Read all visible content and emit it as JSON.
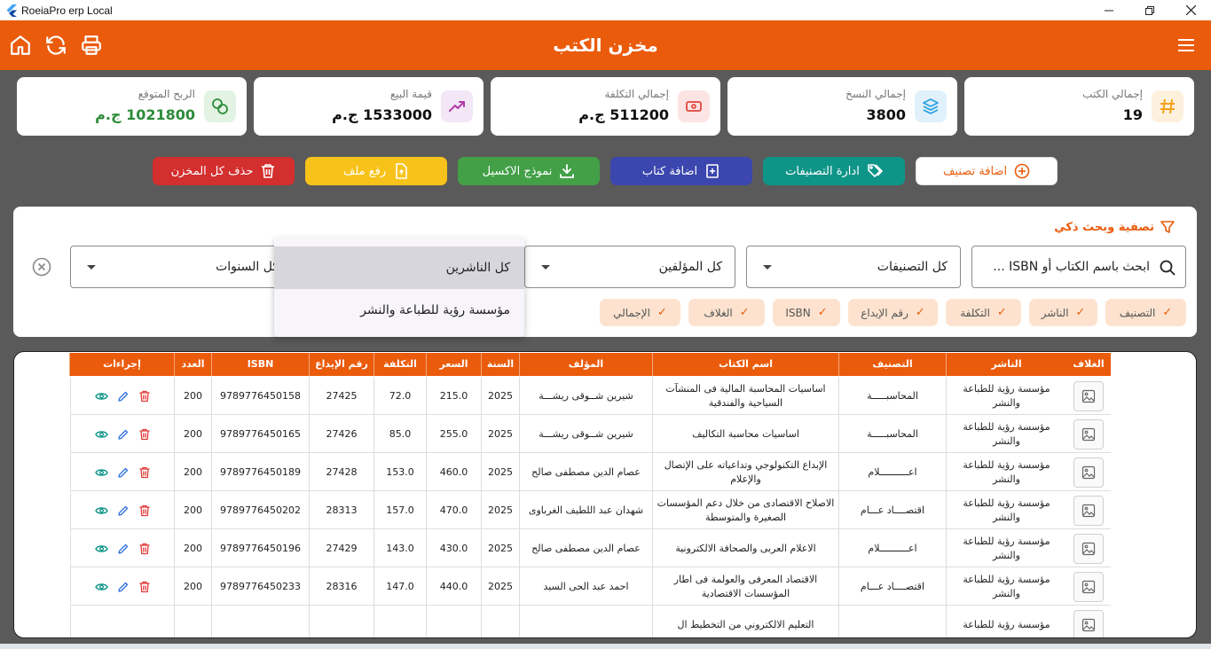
{
  "window": {
    "title": "RoeiaPro erp Local"
  },
  "appbar": {
    "title": "مخزن الكتب"
  },
  "stats": [
    {
      "label": "إجمالي الكتب",
      "value": "19",
      "icon": "hash-icon",
      "bg": "#fdf1dd",
      "color": "#f4a21b"
    },
    {
      "label": "إجمالي النسخ",
      "value": "3800",
      "icon": "layers-icon",
      "bg": "#e1f1fb",
      "color": "#2aa0e0"
    },
    {
      "label": "إجمالي التكلفة",
      "value": "511200 ج.م",
      "icon": "money-icon",
      "bg": "#fde4e4",
      "color": "#e0463b"
    },
    {
      "label": "قيمة البيع",
      "value": "1533000 ج.م",
      "icon": "trend-up-icon",
      "bg": "#f3e6f6",
      "color": "#b03aa8"
    },
    {
      "label": "الربح المتوقع",
      "value": "1021800 ج.م",
      "icon": "coins-icon",
      "bg": "#e2f3e4",
      "color": "#2e8b3a"
    }
  ],
  "actions": [
    {
      "label": "اضافة تصنيف",
      "icon": "plus-circle-icon"
    },
    {
      "label": "ادارة التصنيفات",
      "icon": "tags-icon"
    },
    {
      "label": "اضافة كتاب",
      "icon": "add-book-icon"
    },
    {
      "label": "نموذج الاكسيل",
      "icon": "download-icon"
    },
    {
      "label": "رفع ملف",
      "icon": "upload-file-icon"
    },
    {
      "label": "حذف كل المخزن",
      "icon": "trash-icon"
    }
  ],
  "colors": {
    "accent": "#ea5b0c",
    "teal": "#0f9488",
    "indigo": "#3b46ae",
    "green": "#43a047",
    "yellow": "#f7c21a",
    "red": "#d32f2f"
  },
  "filter": {
    "title": "تصفية وبحث ذكي",
    "search_placeholder": "ابحث باسم الكتاب أو ISBN ...",
    "category": "كل التصنيفات",
    "author": "كل المؤلفين",
    "year": "كل السنوات",
    "publisher_options": [
      "كل الناشرين",
      "مؤسسة رؤية للطباعة والنشر"
    ],
    "chips": [
      "التصنيف",
      "الناشر",
      "التكلفة",
      "رقم الإيداع",
      "ISBN",
      "الغلاف",
      "الإجمالي"
    ]
  },
  "table": {
    "headers": [
      "الغلاف",
      "الناشر",
      "التصنيف",
      "اسم الكتاب",
      "المؤلف",
      "السنة",
      "السعر",
      "التكلفة",
      "رقم الإيداع",
      "ISBN",
      "العدد",
      "إجراءات"
    ],
    "rows": [
      {
        "publisher": "مؤسسة رؤية للطباعة والنشر",
        "category": "المحاسبـــــة",
        "title": "اساسيات المحاسبة المالية فى المنشآت السياحية والفندقية",
        "author": "شيرين شــوقى ريشـــة",
        "year": "2025",
        "price": "215.0",
        "cost": "72.0",
        "deposit": "27425",
        "isbn": "9789776450158",
        "qty": "200"
      },
      {
        "publisher": "مؤسسة رؤية للطباعة والنشر",
        "category": "المحاسبـــــة",
        "title": "اساسيات محاسبة التكاليف",
        "author": "شيرين شــوقى ريشـــة",
        "year": "2025",
        "price": "255.0",
        "cost": "85.0",
        "deposit": "27426",
        "isbn": "9789776450165",
        "qty": "200"
      },
      {
        "publisher": "مؤسسة رؤية للطباعة والنشر",
        "category": "اعــــــــــلام",
        "title": "الإبداع التكنولوجي وتداعياته على الإتصال والإعلام",
        "author": "عصام الدين مصطفى صالح",
        "year": "2025",
        "price": "460.0",
        "cost": "153.0",
        "deposit": "27428",
        "isbn": "9789776450189",
        "qty": "200"
      },
      {
        "publisher": "مؤسسة رؤية للطباعة والنشر",
        "category": "اقتصــــاد عـــام",
        "title": "الاصلاح الاقتصادى من خلال دعم المؤسسات الصغيرة والمتوسطة",
        "author": "شهدان عبد اللطيف الغرباوى",
        "year": "2025",
        "price": "470.0",
        "cost": "157.0",
        "deposit": "28313",
        "isbn": "9789776450202",
        "qty": "200"
      },
      {
        "publisher": "مؤسسة رؤية للطباعة والنشر",
        "category": "اعــــــــــلام",
        "title": "الاعلام العربى والصحافة الالكترونية",
        "author": "عصام الدين مصطفى صالح",
        "year": "2025",
        "price": "430.0",
        "cost": "143.0",
        "deposit": "27429",
        "isbn": "9789776450196",
        "qty": "200"
      },
      {
        "publisher": "مؤسسة رؤية للطباعة والنشر",
        "category": "اقتصــــاد عـــام",
        "title": "الاقتصاد المعرفى والعولمة فى اطار المؤسسات الاقتصادية",
        "author": "احمد عبد الحى السيد",
        "year": "2025",
        "price": "440.0",
        "cost": "147.0",
        "deposit": "28316",
        "isbn": "9789776450233",
        "qty": "200"
      },
      {
        "publisher": "مؤسسة رؤية للطباعة",
        "category": "",
        "title": "التعليم الالكتروني من التخطيط ال",
        "author": "",
        "year": "",
        "price": "",
        "cost": "",
        "deposit": "",
        "isbn": "",
        "qty": ""
      }
    ]
  }
}
